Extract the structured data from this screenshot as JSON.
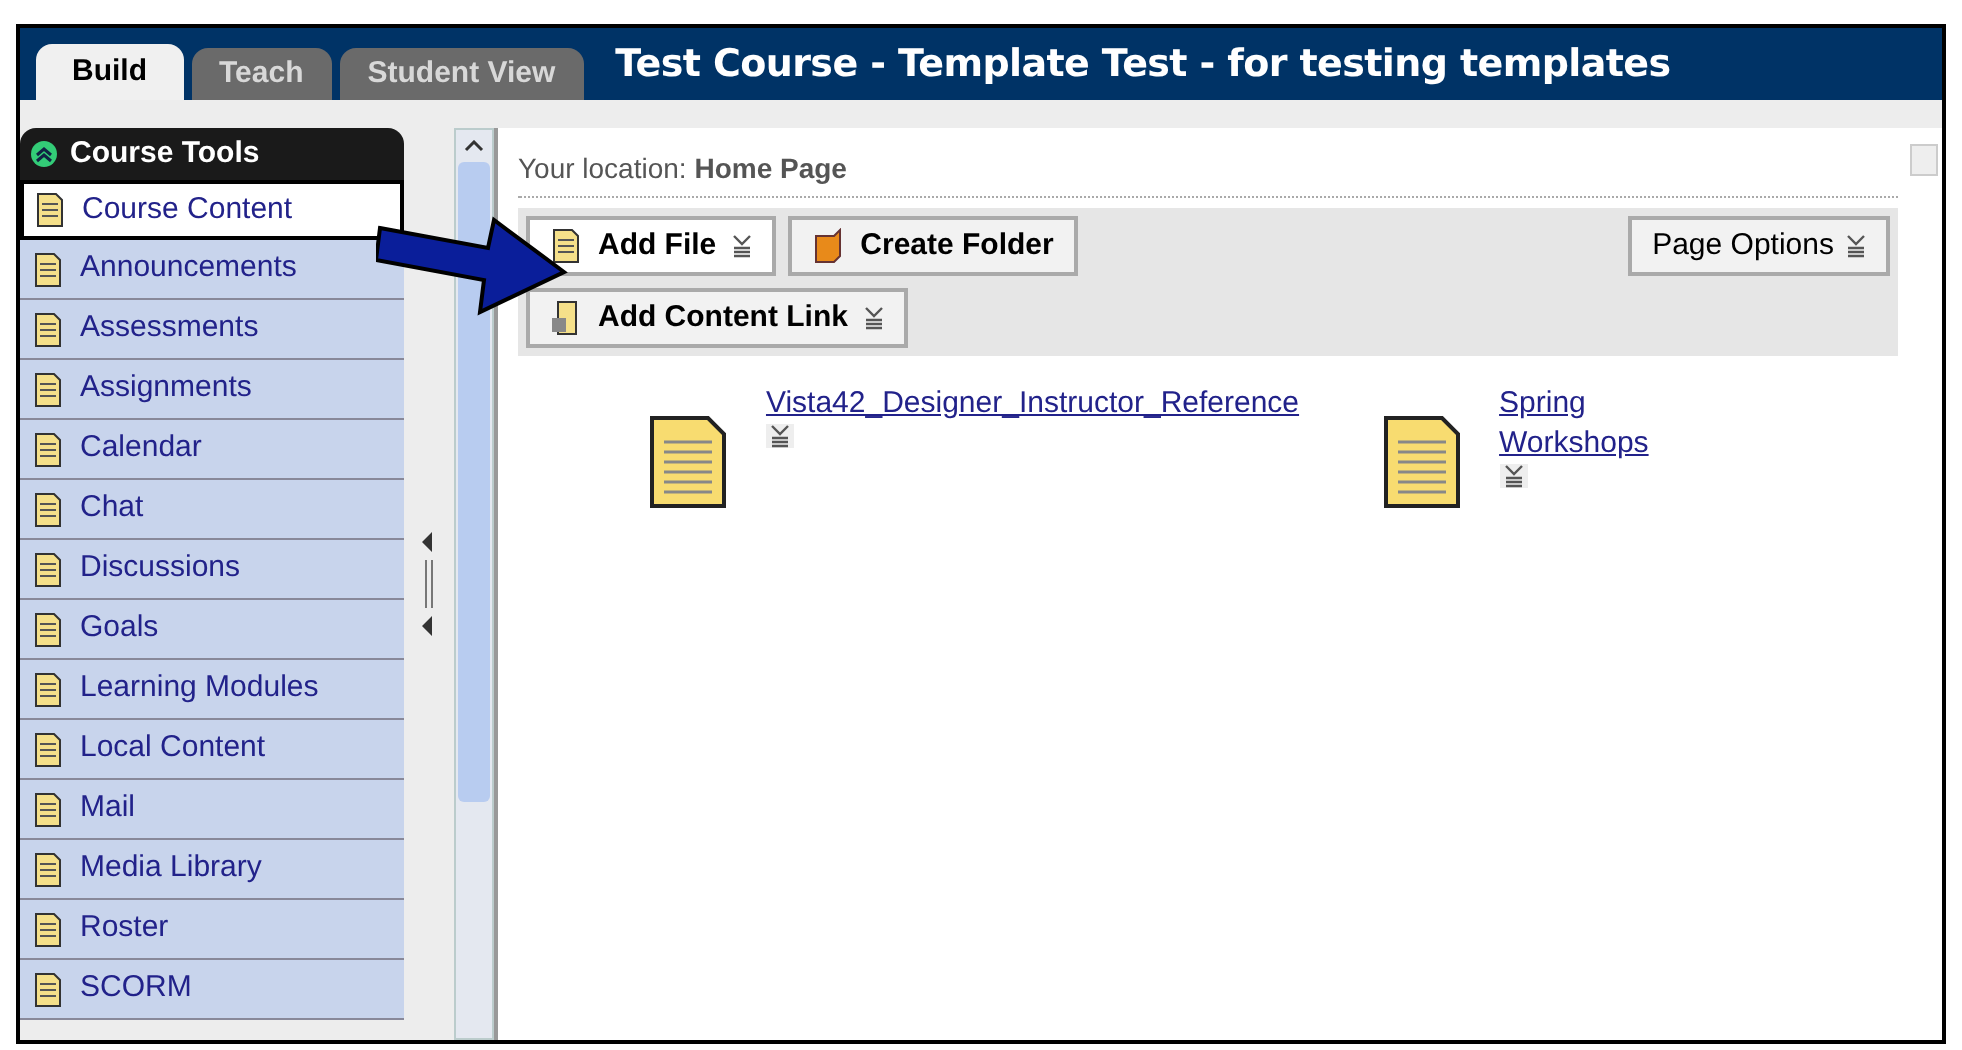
{
  "tabs": [
    {
      "label": "Build",
      "selected": true
    },
    {
      "label": "Teach",
      "selected": false
    },
    {
      "label": "Student View",
      "selected": false
    }
  ],
  "course_title": "Test Course - Template Test - for testing templates",
  "sidebar": {
    "title": "Course Tools",
    "items": [
      {
        "label": "Course Content",
        "selected": true
      },
      {
        "label": "Announcements",
        "selected": false
      },
      {
        "label": "Assessments",
        "selected": false
      },
      {
        "label": "Assignments",
        "selected": false
      },
      {
        "label": "Calendar",
        "selected": false
      },
      {
        "label": "Chat",
        "selected": false
      },
      {
        "label": "Discussions",
        "selected": false
      },
      {
        "label": "Goals",
        "selected": false
      },
      {
        "label": "Learning Modules",
        "selected": false
      },
      {
        "label": "Local Content",
        "selected": false
      },
      {
        "label": "Mail",
        "selected": false
      },
      {
        "label": "Media Library",
        "selected": false
      },
      {
        "label": "Roster",
        "selected": false
      },
      {
        "label": "SCORM",
        "selected": false
      }
    ]
  },
  "location": "Your location: **Home Page**",
  "toolbar": [
    {
      "label": "Add File",
      "kind": "file",
      "menu": true
    },
    {
      "label": "Create Folder",
      "kind": "folder",
      "menu": false
    },
    {
      "label": "Add Content Link",
      "kind": "link",
      "menu": true
    }
  ],
  "page_options": "Page Options",
  "files": [
    {
      "label": "Vista42_Designer_Instructor_Reference"
    },
    {
      "label": "Spring Workshops"
    }
  ]
}
